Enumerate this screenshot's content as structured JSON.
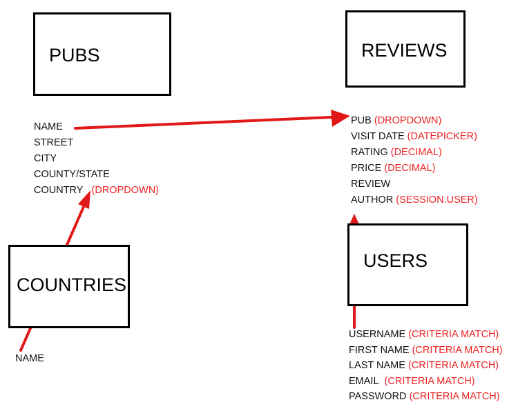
{
  "colors": {
    "arrow": "#e01818",
    "note": "#ee2222",
    "box_border": "#000000"
  },
  "entities": {
    "pubs": {
      "title": "PUBS"
    },
    "reviews": {
      "title": "REVIEWS"
    },
    "countries": {
      "title": "COUNTRIES"
    },
    "users": {
      "title": "USERS"
    }
  },
  "pubs_fields": [
    {
      "name": "NAME",
      "note": ""
    },
    {
      "name": "STREET",
      "note": ""
    },
    {
      "name": "CITY",
      "note": ""
    },
    {
      "name": "COUNTY/STATE",
      "note": ""
    },
    {
      "name": "COUNTRY",
      "note": "(DROPDOWN)"
    }
  ],
  "reviews_fields": [
    {
      "name": "PUB",
      "note": "(DROPDOWN)"
    },
    {
      "name": "VISIT DATE",
      "note": "(DATEPICKER)"
    },
    {
      "name": "RATING",
      "note": "(DECIMAL)"
    },
    {
      "name": "PRICE",
      "note": "(DECIMAL)"
    },
    {
      "name": "REVIEW",
      "note": ""
    },
    {
      "name": "AUTHOR",
      "note": "(SESSION.USER)"
    }
  ],
  "countries_fields": [
    {
      "name": "NAME",
      "note": ""
    }
  ],
  "users_fields": [
    {
      "name": "USERNAME",
      "note": "(CRITERIA MATCH)"
    },
    {
      "name": "FIRST NAME",
      "note": "(CRITERIA MATCH)"
    },
    {
      "name": "LAST NAME",
      "note": "(CRITERIA MATCH)"
    },
    {
      "name": "EMAIL",
      "note": "(CRITERIA MATCH)"
    },
    {
      "name": "PASSWORD",
      "note": "(CRITERIA MATCH)"
    }
  ],
  "relationships": [
    {
      "from": "pubs.NAME",
      "to": "reviews.PUB"
    },
    {
      "from": "countries.NAME",
      "to": "pubs.COUNTRY"
    },
    {
      "from": "users.USERNAME",
      "to": "reviews.AUTHOR"
    }
  ]
}
